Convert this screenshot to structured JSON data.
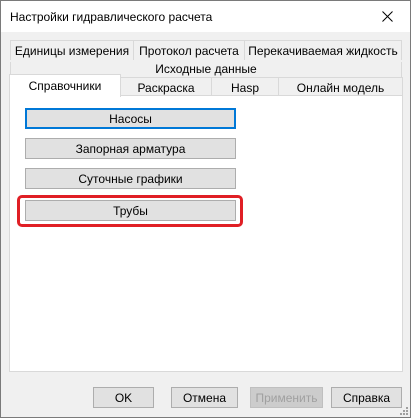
{
  "window": {
    "title": "Настройки гидравлического расчета",
    "close_icon": "close-icon"
  },
  "tabs": {
    "row1": [
      "Единицы измерения",
      "Протокол расчета",
      "Перекачиваемая жидкость"
    ],
    "row2": [
      "Исходные данные"
    ],
    "row3": [
      "Справочники",
      "Раскраска",
      "Hasp",
      "Онлайн модель"
    ],
    "active": "Справочники"
  },
  "panel": {
    "buttons": [
      "Насосы",
      "Запорная арматура",
      "Суточные графики",
      "Трубы"
    ],
    "highlighted": "Трубы"
  },
  "footer": {
    "ok": "OK",
    "cancel": "Отмена",
    "apply": "Применить",
    "help": "Справка"
  },
  "colors": {
    "highlight": "#e01f25",
    "focus": "#0078d7"
  }
}
